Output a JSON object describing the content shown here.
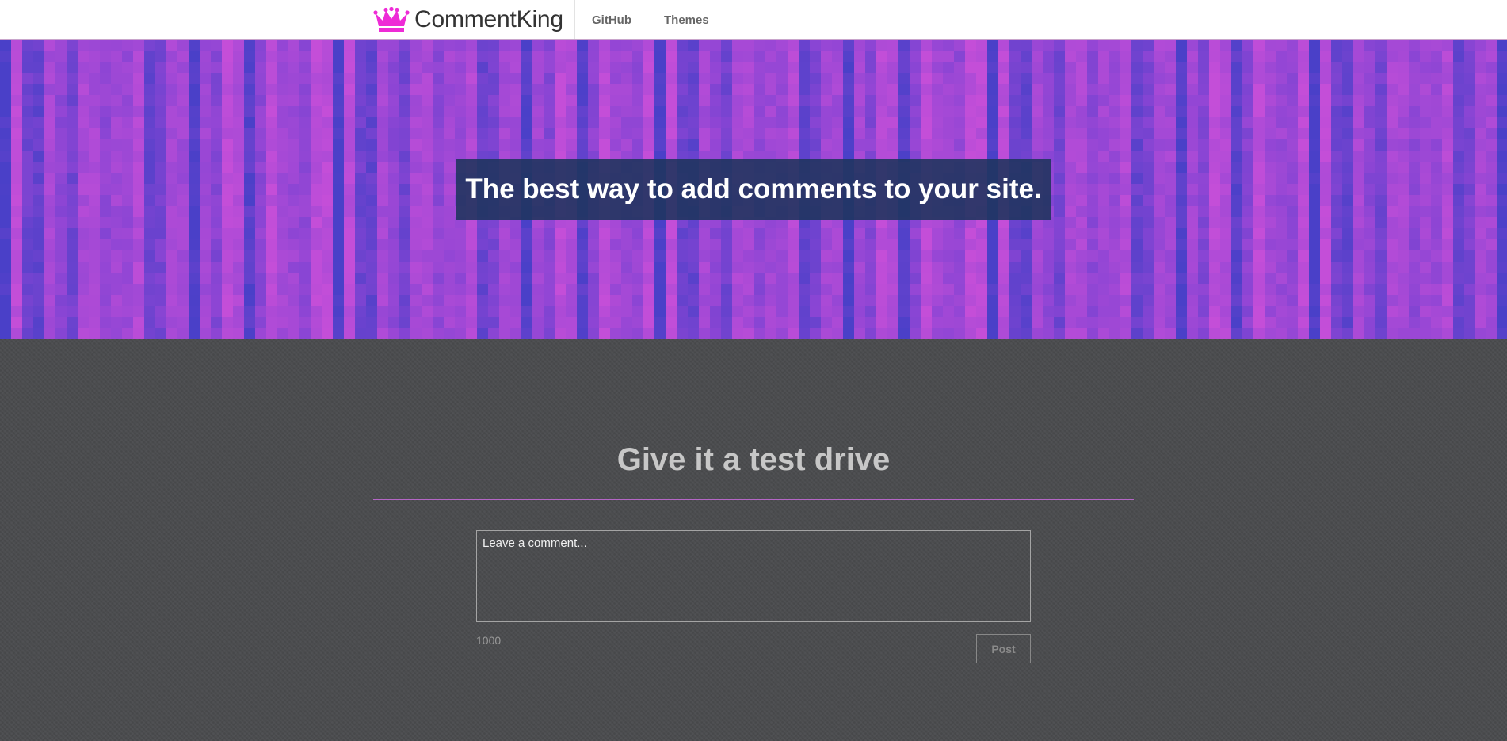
{
  "brand": {
    "name": "CommentKing",
    "logo_icon": "crown-icon",
    "logo_color": "#ee2bd6"
  },
  "nav": {
    "items": [
      {
        "label": "GitHub"
      },
      {
        "label": "Themes"
      }
    ]
  },
  "hero": {
    "tagline": "The best way to add comments to your site.",
    "colors": {
      "magenta": "#c44ed8",
      "purple": "#8b45d4",
      "blue": "#4a40c8"
    }
  },
  "demo": {
    "title": "Give it a test drive",
    "comment_placeholder": "Leave a comment...",
    "char_count": "1000",
    "post_label": "Post",
    "accent_color": "#b466c6"
  }
}
